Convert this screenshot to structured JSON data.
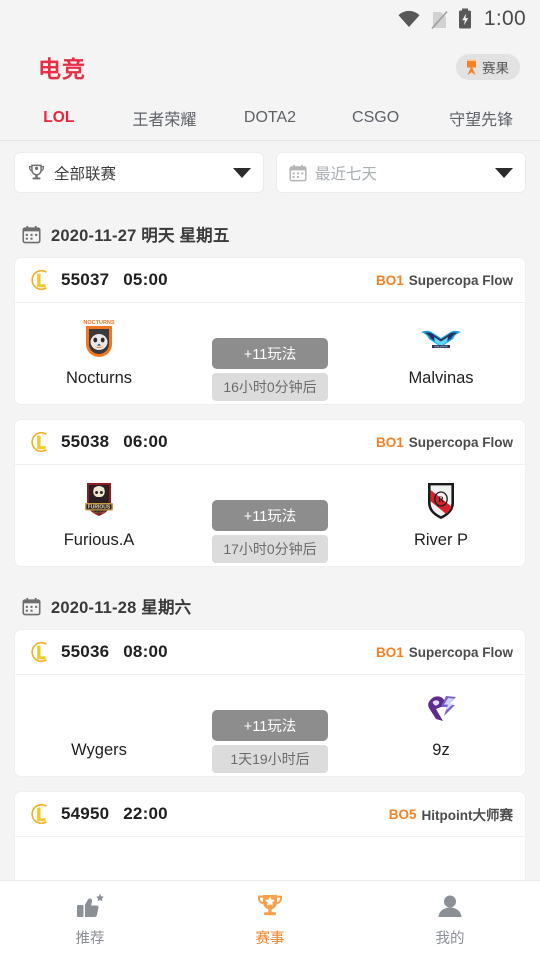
{
  "statusbar": {
    "time": "1:00",
    "icons": [
      "wifi-icon",
      "no-sim-icon",
      "battery-charging-icon"
    ]
  },
  "header": {
    "brand": "电竞",
    "result_badge": {
      "label": "赛果",
      "icon": "medal-icon"
    },
    "brand_color": "#e82f45"
  },
  "tabs": [
    {
      "label": "LOL",
      "active": true
    },
    {
      "label": "王者荣耀",
      "active": false
    },
    {
      "label": "DOTA2",
      "active": false
    },
    {
      "label": "CSGO",
      "active": false
    },
    {
      "label": "守望先锋",
      "active": false
    }
  ],
  "filters": [
    {
      "name": "league-filter",
      "icon": "trophy-icon",
      "value": "全部联赛",
      "is_placeholder": false
    },
    {
      "name": "date-filter",
      "icon": "calendar-icon",
      "value": "最近七天",
      "is_placeholder": true
    }
  ],
  "sections": [
    {
      "date_label": "2020-11-27 明天 星期五",
      "matches": [
        {
          "match_id": "55037",
          "time": "05:00",
          "bo": "BO1",
          "league": "Supercopa Flow",
          "home": {
            "name": "Nocturns",
            "logo": "nocturns-logo"
          },
          "away": {
            "name": "Malvinas",
            "logo": "malvinas-logo"
          },
          "play_label": "+11玩法",
          "countdown": "16小时0分钟后"
        },
        {
          "match_id": "55038",
          "time": "06:00",
          "bo": "BO1",
          "league": "Supercopa Flow",
          "home": {
            "name": "Furious.A",
            "logo": "furious-logo"
          },
          "away": {
            "name": "River P",
            "logo": "river-plate-logo"
          },
          "play_label": "+11玩法",
          "countdown": "17小时0分钟后"
        }
      ]
    },
    {
      "date_label": "2020-11-28 星期六",
      "matches": [
        {
          "match_id": "55036",
          "time": "08:00",
          "bo": "BO1",
          "league": "Supercopa Flow",
          "home": {
            "name": "Wygers",
            "logo": "none"
          },
          "away": {
            "name": "9z",
            "logo": "nine-z-logo"
          },
          "play_label": "+11玩法",
          "countdown": "1天19小时后"
        },
        {
          "match_id": "54950",
          "time": "22:00",
          "bo": "BO5",
          "league": "Hitpoint大师赛",
          "home": {
            "name": "",
            "logo": "none"
          },
          "away": {
            "name": "",
            "logo": "none"
          },
          "play_label": "",
          "countdown": ""
        }
      ]
    }
  ],
  "bottomnav": [
    {
      "label": "推荐",
      "icon": "thumbs-up-star-icon",
      "active": false
    },
    {
      "label": "赛事",
      "icon": "trophy-star-icon",
      "active": true
    },
    {
      "label": "我的",
      "icon": "person-icon",
      "active": false
    }
  ],
  "colors": {
    "brand_red": "#e8233c",
    "accent_orange": "#f68023",
    "page_bg": "#f4f4f4",
    "card_bg": "#ffffff"
  }
}
